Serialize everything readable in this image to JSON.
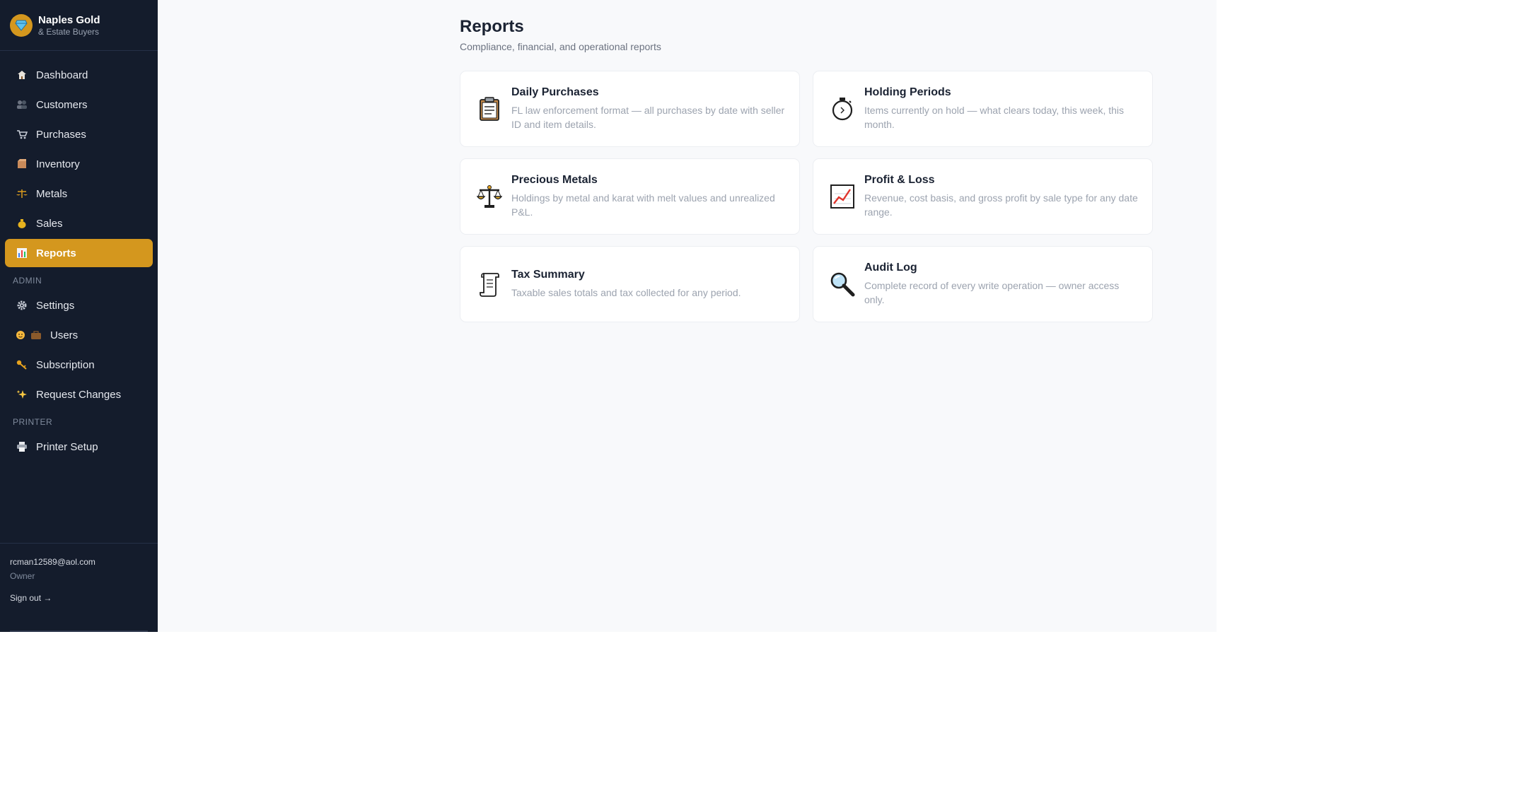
{
  "brand": {
    "title": "Naples Gold",
    "subtitle": "& Estate Buyers"
  },
  "nav": {
    "items": [
      {
        "label": "Dashboard",
        "icon": "house-icon"
      },
      {
        "label": "Customers",
        "icon": "people-icon"
      },
      {
        "label": "Purchases",
        "icon": "cart-icon"
      },
      {
        "label": "Inventory",
        "icon": "box-icon"
      },
      {
        "label": "Metals",
        "icon": "scale-icon"
      },
      {
        "label": "Sales",
        "icon": "money-bag-icon"
      },
      {
        "label": "Reports",
        "icon": "bar-chart-icon",
        "active": true
      }
    ],
    "admin_label": "ADMIN",
    "admin_items": [
      {
        "label": "Settings",
        "icon": "gear-icon"
      },
      {
        "label": "Users",
        "icon": "users-icon"
      },
      {
        "label": "Subscription",
        "icon": "key-icon"
      },
      {
        "label": "Request Changes",
        "icon": "sparkle-icon"
      }
    ],
    "printer_label": "PRINTER",
    "printer_items": [
      {
        "label": "Printer Setup",
        "icon": "printer-icon"
      }
    ]
  },
  "user": {
    "email": "rcman12589@aol.com",
    "role": "Owner",
    "signout": "Sign out →"
  },
  "page": {
    "title": "Reports",
    "subtitle": "Compliance, financial, and operational reports"
  },
  "reports": [
    {
      "title": "Daily Purchases",
      "description": "FL law enforcement format — all purchases by date with seller ID and item details.",
      "icon": "clipboard-icon"
    },
    {
      "title": "Holding Periods",
      "description": "Items currently on hold — what clears today, this week, this month.",
      "icon": "stopwatch-icon"
    },
    {
      "title": "Precious Metals",
      "description": "Holdings by metal and karat with melt values and unrealized P&L.",
      "icon": "balance-scale-icon"
    },
    {
      "title": "Profit & Loss",
      "description": "Revenue, cost basis, and gross profit by sale type for any date range.",
      "icon": "line-chart-icon"
    },
    {
      "title": "Tax Summary",
      "description": "Taxable sales totals and tax collected for any period.",
      "icon": "scroll-icon"
    },
    {
      "title": "Audit Log",
      "description": "Complete record of every write operation — owner access only.",
      "icon": "magnifier-icon"
    }
  ],
  "colors": {
    "sidebar_bg": "#141c2c",
    "accent": "#d4971e",
    "main_bg": "#f8f9fb"
  }
}
